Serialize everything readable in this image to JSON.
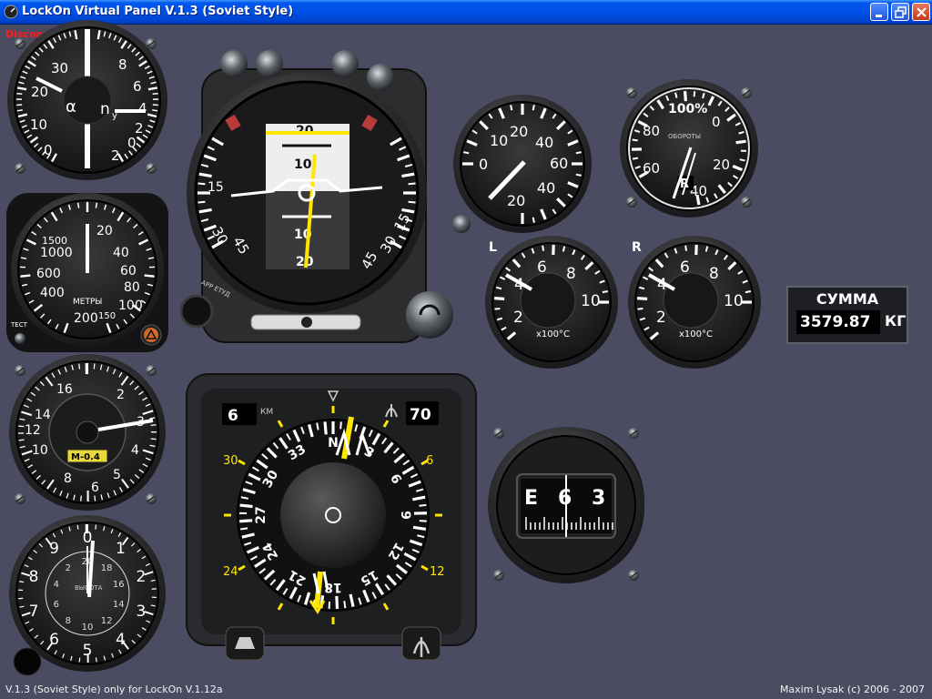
{
  "window": {
    "title": "LockOn Virtual Panel V.1.3 (Soviet Style)",
    "icon": "app-icon",
    "buttons": [
      "minimize-icon",
      "restore-icon",
      "close-icon"
    ]
  },
  "connection_status": "Disconnected",
  "gauges": {
    "aoa_g": {
      "left_labels": [
        "30",
        "20",
        "10",
        "0"
      ],
      "right_labels": [
        "8",
        "6",
        "4",
        "2",
        "0",
        "2"
      ],
      "alpha_symbol": "α",
      "ny_symbol": "n",
      "ny_sub": "y",
      "aoa_value": 22,
      "g_value": 4
    },
    "altimeter_radar": {
      "labels": [
        "1500",
        "1000",
        "600",
        "400",
        "20",
        "40",
        "60",
        "80",
        "100",
        "200",
        "150"
      ],
      "unit_label": "МЕТРЫ",
      "test_label": "ТЕСТ",
      "value_m": 0
    },
    "airspeed_mach": {
      "labels": [
        "16",
        "14",
        "12",
        "10",
        "8",
        "6",
        "5",
        "4",
        "3",
        "2"
      ],
      "mach_label": "М-0.4",
      "mach_value": 0.4
    },
    "altimeter_baro": {
      "outer_labels": [
        "0",
        "1",
        "2",
        "3",
        "4",
        "5",
        "6",
        "7",
        "8",
        "9"
      ],
      "inner_labels": [
        "20",
        "18",
        "16",
        "14",
        "12",
        "10",
        "8",
        "6",
        "4",
        "2"
      ],
      "center_text": "ВЫСОТА",
      "value": 0
    },
    "adi": {
      "pitch_labels": [
        "20",
        "10",
        "10",
        "20"
      ],
      "bank_labels": [
        "45",
        "30",
        "15",
        "15",
        "30",
        "45"
      ],
      "button_label": "АРР ЕТУД"
    },
    "hsi": {
      "distance_value": "6",
      "distance_unit": "КМ",
      "course_value": "70",
      "outer_labels": [
        "30",
        "6",
        "24",
        "12"
      ],
      "compass_labels": [
        "N",
        "3",
        "6",
        "9",
        "12",
        "15",
        "18",
        "21",
        "24",
        "27",
        "30",
        "33"
      ],
      "heading_deg": 3
    },
    "vvi": {
      "labels": [
        "10",
        "20",
        "40",
        "60",
        "40",
        "20",
        "0"
      ],
      "value": 0
    },
    "rpm": {
      "labels": [
        "100%",
        "0",
        "80",
        "ОБОРОТЫ",
        "20",
        "60",
        "40"
      ],
      "engine_label": "R",
      "value_pct": 56
    },
    "egt_left": {
      "side": "L",
      "labels": [
        "2",
        "4",
        "6",
        "8",
        "10"
      ],
      "unit": "x100°C",
      "value": 3.6
    },
    "egt_right": {
      "side": "R",
      "labels": [
        "2",
        "4",
        "6",
        "8",
        "10"
      ],
      "unit": "x100°C",
      "value": 3.6
    },
    "compass": {
      "heading_text": [
        "E",
        "6",
        "3"
      ],
      "value_deg": 63
    }
  },
  "fuel": {
    "label": "СУММА",
    "value": "3579.87",
    "unit": "КГ"
  },
  "footer": {
    "left": "V.1.3 (Soviet Style) only for LockOn V.1.12a",
    "right": "Maxim Lysak (c) 2006 - 2007"
  },
  "colors": {
    "background": "#4b4c62",
    "title_bar": "#0055e5",
    "status": "#ff1a1a",
    "needle": "#ffffff",
    "marker": "#ffe600"
  }
}
